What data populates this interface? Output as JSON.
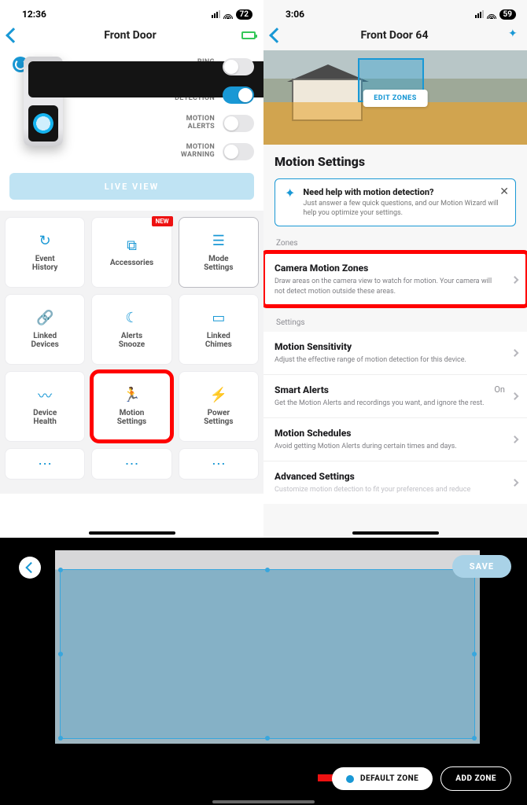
{
  "left": {
    "status": {
      "time": "12:36",
      "battery": "72"
    },
    "title": "Front Door",
    "toggles": [
      {
        "label": "RING\nALERTS",
        "on": false
      },
      {
        "label": "MOTION\nDETECTION",
        "on": true
      },
      {
        "label": "MOTION\nALERTS",
        "on": false
      },
      {
        "label": "MOTION\nWARNING",
        "on": false
      }
    ],
    "liveView": "LIVE VIEW",
    "newBadge": "NEW",
    "cards": [
      {
        "label": "Event\nHistory",
        "icon": "history-icon"
      },
      {
        "label": "Accessories",
        "icon": "accessories-icon",
        "new": true
      },
      {
        "label": "Mode\nSettings",
        "icon": "mode-icon",
        "selected": true
      },
      {
        "label": "Linked\nDevices",
        "icon": "link-icon"
      },
      {
        "label": "Alerts\nSnooze",
        "icon": "snooze-icon"
      },
      {
        "label": "Linked\nChimes",
        "icon": "chime-icon"
      },
      {
        "label": "Device\nHealth",
        "icon": "health-icon"
      },
      {
        "label": "Motion\nSettings",
        "icon": "motion-icon",
        "highlight": true
      },
      {
        "label": "Power\nSettings",
        "icon": "power-icon"
      }
    ]
  },
  "right": {
    "status": {
      "time": "3:06",
      "battery": "59"
    },
    "title": "Front Door 64",
    "editZones": "EDIT ZONES",
    "pageTitle": "Motion Settings",
    "help": {
      "title": "Need help with motion detection?",
      "sub": "Just answer a few quick questions, and our Motion Wizard will help you optimize your settings."
    },
    "zonesLabel": "Zones",
    "zonesRow": {
      "title": "Camera Motion Zones",
      "sub": "Draw areas on the camera view to watch for motion. Your camera will not detect motion outside these areas."
    },
    "settingsLabel": "Settings",
    "rows": [
      {
        "title": "Motion Sensitivity",
        "sub": "Adjust the effective range of motion detection for this device."
      },
      {
        "title": "Smart Alerts",
        "sub": "Get the Motion Alerts and recordings you want, and ignore the rest.",
        "value": "On"
      },
      {
        "title": "Motion Schedules",
        "sub": "Avoid getting Motion Alerts during certain times and days."
      },
      {
        "title": "Advanced Settings",
        "sub": "Customize motion detection to fit your preferences and reduce"
      }
    ]
  },
  "editor": {
    "save": "SAVE",
    "defaultZone": "DEFAULT ZONE",
    "addZone": "ADD ZONE"
  }
}
